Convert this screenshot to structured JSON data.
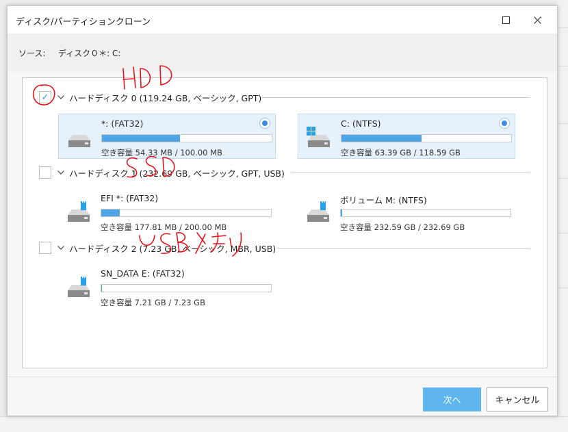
{
  "dialog": {
    "title": "ディスク/パーティションクローン",
    "source_label": "ソース:",
    "source_value": "ディスク０＊: C:"
  },
  "disks": [
    {
      "title": "ハードディスク 0 (119.24 GB, ベーシック, GPT)",
      "checked": true,
      "partitions": [
        {
          "name": "*: (FAT32)",
          "free": "空き容量 54.33 MB / 100.00 MB",
          "used_fraction": 0.46,
          "icon": "drive-icon",
          "selected": true
        },
        {
          "name": "C: (NTFS)",
          "free": "空き容量 63.39 GB / 118.59 GB",
          "used_fraction": 0.47,
          "icon": "windows-drive-icon",
          "selected": true
        }
      ]
    },
    {
      "title": "ハードディスク 1 (232.69 GB, ベーシック, GPT, USB)",
      "checked": false,
      "partitions": [
        {
          "name": "EFI *: (FAT32)",
          "free": "空き容量 177.81 MB / 200.00 MB",
          "used_fraction": 0.11,
          "icon": "usb-drive-icon",
          "selected": false
        },
        {
          "name": "ボリューム M: (NTFS)",
          "free": "空き容量 232.59 GB / 232.69 GB",
          "used_fraction": 0.004,
          "icon": "usb-drive-icon",
          "selected": false
        }
      ]
    },
    {
      "title": "ハードディスク 2 (7.23 GB, ベーシック, MBR, USB)",
      "checked": false,
      "partitions": [
        {
          "name": "SN_DATA E: (FAT32)",
          "free": "空き容量 7.21 GB / 7.23 GB",
          "used_fraction": 0.003,
          "icon": "usb-drive-icon",
          "selected": false
        }
      ]
    }
  ],
  "buttons": {
    "next": "次へ",
    "cancel": "キャンセル"
  },
  "annotations": [
    "HDD",
    "SSD",
    "USBメモリ"
  ],
  "colors": {
    "accent": "#3a8ee6",
    "bar_fill": "#4ea6e6",
    "selected_bg": "#e6f1fb",
    "next_button": "#5fb6ee",
    "annotation": "#e8141c"
  }
}
